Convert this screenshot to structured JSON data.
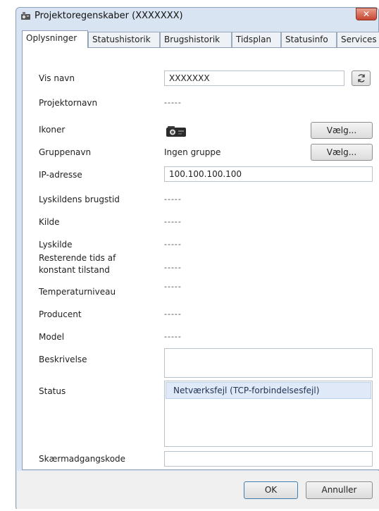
{
  "window": {
    "title": "Projektoregenskaber (XXXXXXX)",
    "close_glyph": "✕"
  },
  "tabs": [
    {
      "label": "Oplysninger",
      "active": true
    },
    {
      "label": "Statushistorik",
      "active": false
    },
    {
      "label": "Brugshistorik",
      "active": false
    },
    {
      "label": "Tidsplan",
      "active": false
    },
    {
      "label": "Statusinfo",
      "active": false
    },
    {
      "label": "Services",
      "active": false
    }
  ],
  "fields": {
    "display_name": {
      "label": "Vis navn",
      "value": "XXXXXXX",
      "refresh_icon": "refresh-icon"
    },
    "projector_name": {
      "label": "Projektornavn",
      "value": "-----"
    },
    "icons": {
      "label": "Ikoner",
      "icon": "projector-icon",
      "button": "Vælg..."
    },
    "group_name": {
      "label": "Gruppenavn",
      "value": "Ingen gruppe",
      "button": "Vælg..."
    },
    "ip_address": {
      "label": "IP-adresse",
      "value": "100.100.100.100"
    },
    "light_source_hours": {
      "label": "Lyskildens brugstid",
      "value": "-----"
    },
    "source": {
      "label": "Kilde",
      "value": "-----"
    },
    "light_source": {
      "label": "Lyskilde",
      "value": "-----"
    },
    "constant_mode_remaining": {
      "label": "Resterende tids af konstant tilstand",
      "value": "-----"
    },
    "temperature_level": {
      "label": "Temperaturniveau",
      "value": "-----"
    },
    "manufacturer": {
      "label": "Producent",
      "value": "-----"
    },
    "model": {
      "label": "Model",
      "value": "-----"
    },
    "description": {
      "label": "Beskrivelse",
      "value": ""
    },
    "status": {
      "label": "Status",
      "items": [
        "Netværksfejl (TCP-forbindelsesfejl)"
      ]
    },
    "screen_password": {
      "label": "Skærmadgangskode",
      "value": ""
    }
  },
  "footer": {
    "ok_label": "OK",
    "cancel_label": "Annuller"
  },
  "colors": {
    "window_frame": "#d8e4f1",
    "close_button": "#c7452f",
    "status_selection": "#dfe9f7"
  }
}
